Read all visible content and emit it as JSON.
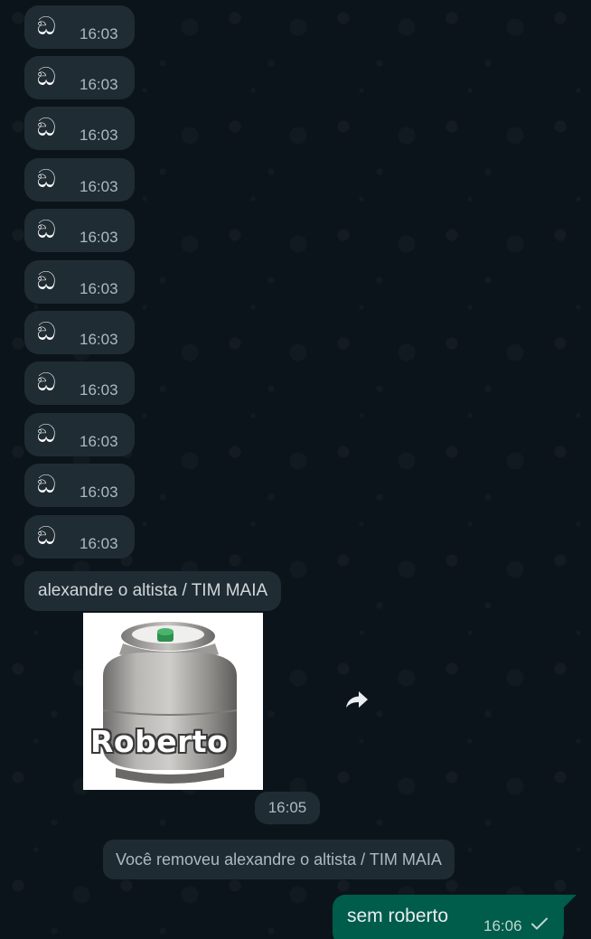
{
  "messages": [
    {
      "emoji": "ඞ",
      "time": "16:03"
    },
    {
      "emoji": "ඞ",
      "time": "16:03"
    },
    {
      "emoji": "ඞ",
      "time": "16:03"
    },
    {
      "emoji": "ඞ",
      "time": "16:03"
    },
    {
      "emoji": "ඞ",
      "time": "16:03"
    },
    {
      "emoji": "ඞ",
      "time": "16:03"
    },
    {
      "emoji": "ඞ",
      "time": "16:03"
    },
    {
      "emoji": "ඞ",
      "time": "16:03"
    },
    {
      "emoji": "ඞ",
      "time": "16:03"
    },
    {
      "emoji": "ඞ",
      "time": "16:03"
    },
    {
      "emoji": "ඞ",
      "time": "16:03"
    }
  ],
  "sender_name": "alexandre o altista / TIM MAIA",
  "sticker": {
    "caption": "Roberto",
    "time": "16:05",
    "forward_icon": "forward-arrow-icon"
  },
  "system_message": "Você removeu alexandre o altista / TIM MAIA",
  "outgoing": {
    "text": "sem roberto",
    "time": "16:06",
    "status_icon": "check-icon"
  },
  "colors": {
    "background": "#0b141a",
    "incoming_bubble": "#202c33",
    "outgoing_bubble": "#005c4b",
    "timestamp": "#aebac1"
  }
}
